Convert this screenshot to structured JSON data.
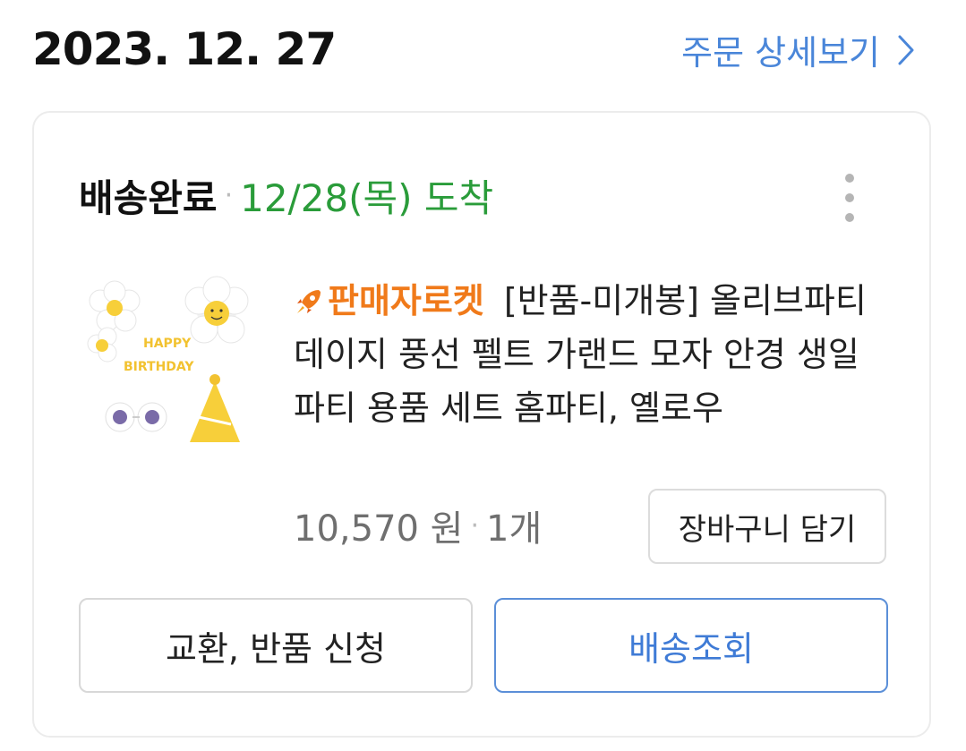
{
  "order": {
    "date": "2023. 12. 27",
    "detail_link": "주문 상세보기"
  },
  "delivery": {
    "status": "배송완료",
    "arrival": "12/28(목) 도착"
  },
  "product": {
    "badge": "판매자로켓",
    "title": "[반품-미개봉] 올리브파티 데이지 풍선 펠트 가랜드 모자 안경 생일파티 용품 세트 홈파티, 옐로우",
    "thumb_text_1": "HAPPY",
    "thumb_text_2": "BIRTHDAY",
    "price": "10,570 원",
    "quantity": "1개"
  },
  "actions": {
    "cart": "장바구니 담기",
    "exchange": "교환, 반품 신청",
    "track": "배송조회"
  },
  "colors": {
    "link_blue": "#4a86d9",
    "arrival_green": "#2a9c3a",
    "rocket_orange": "#f07a1a"
  },
  "icons": {
    "detail": "chevron-right-icon",
    "menu": "more-vertical-icon",
    "badge": "rocket-icon"
  }
}
